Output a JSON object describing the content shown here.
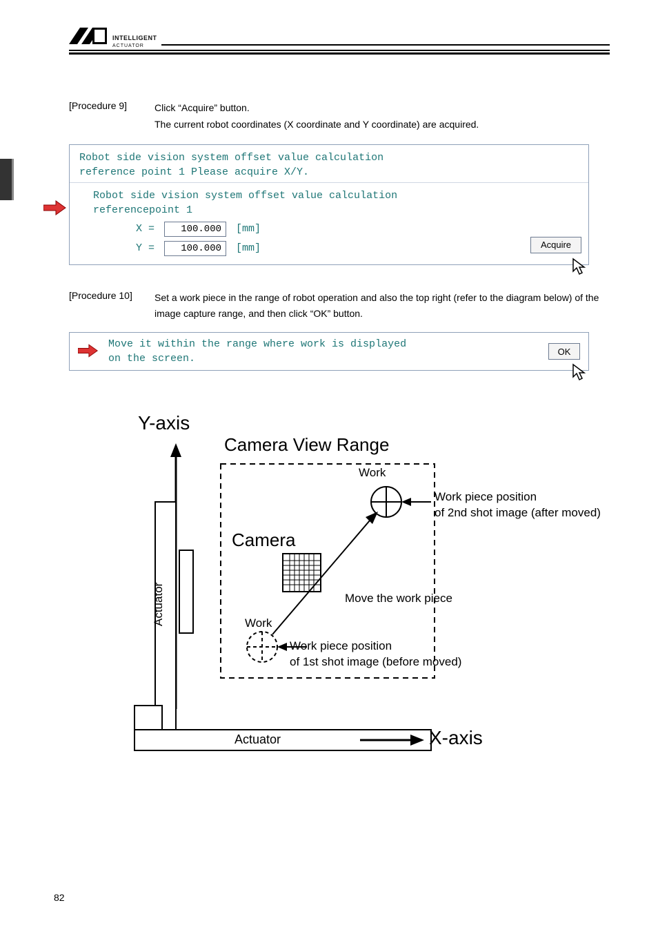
{
  "logo": {
    "brand_top": "INTELLIGENT",
    "brand_bottom": "ACTUATOR"
  },
  "procedure9": {
    "label": "[Procedure 9]",
    "line1": "Click “Acquire” button.",
    "line2": "The current robot coordinates (X coordinate and Y coordinate) are acquired."
  },
  "dialog1": {
    "title1": "Robot side vision system offset value calculation",
    "title2": "reference point 1 Please acquire X/Y.",
    "body1": "Robot side vision system offset value calculation",
    "body2": "referencepoint 1",
    "x_label": "X =",
    "x_value": "100.000",
    "x_unit": "[mm]",
    "y_label": "Y =",
    "y_value": "100.000",
    "y_unit": "[mm]",
    "acquire_button": "Acquire"
  },
  "procedure10": {
    "label": "[Procedure 10]",
    "text": "Set a work piece in the range of robot operation and also the top right (refer to the diagram below) of the image capture range, and then click “OK” button."
  },
  "dialog2": {
    "msg_line1": "Move it within the range where work is displayed",
    "msg_line2": "on the screen.",
    "ok_button": "OK"
  },
  "diagram": {
    "y_axis": "Y-axis",
    "x_axis": "X-axis",
    "camera_view": "Camera View Range",
    "camera": "Camera",
    "actuator_v": "Actuator",
    "actuator_h": "Actuator",
    "work1": "Work",
    "work2": "Work",
    "pos2_l1": "Work piece position",
    "pos2_l2": "of 2nd shot image (after moved)",
    "pos1_l1": "Work piece position",
    "pos1_l2": "of 1st shot image (before moved)",
    "move_label": "Move the work piece"
  },
  "page_number": "82"
}
